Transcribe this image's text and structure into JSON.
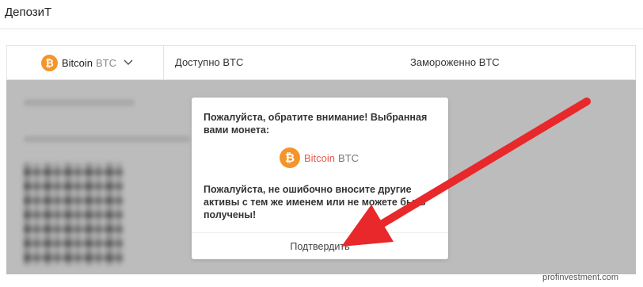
{
  "page": {
    "title": "ДепозиТ"
  },
  "header": {
    "coin": {
      "icon": "bitcoin-icon",
      "icon_glyph": "₿",
      "name": "Bitcoin",
      "ticker": "BTC"
    },
    "available_label": "Доступно BTC",
    "frozen_label": "Замороженно BTC"
  },
  "modal": {
    "notice_text": "Пожалуйста, обратите внимание! Выбранная вами монета:",
    "coin": {
      "icon": "bitcoin-icon",
      "icon_glyph": "₿",
      "name": "Bitcoin",
      "ticker": "BTC"
    },
    "warning_text": "Пожалуйста, не ошибочно вносите другие активы с тем же именем или не можете быть получены!",
    "confirm_label": "Подтвердить"
  },
  "colors": {
    "bitcoin": "#f4942a",
    "annotation_arrow": "#e8282b",
    "coin_name_accent": "#e35a4f"
  },
  "watermark": "profinvestment.com"
}
